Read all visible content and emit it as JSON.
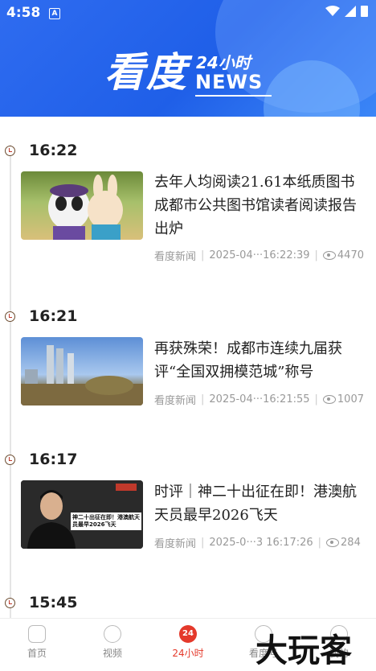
{
  "status_bar": {
    "time": "4:58",
    "notif_badge": "A"
  },
  "header": {
    "logo_cn": "看度",
    "logo_24": "24小时",
    "logo_news": "NEWS"
  },
  "timeline": [
    {
      "time": "16:22",
      "title": "去年人均阅读21.61本纸质图书 成都市公共图书馆读者阅读报告出炉",
      "source": "看度新闻",
      "date": "2025-04···16:22:39",
      "views": "4470"
    },
    {
      "time": "16:21",
      "title": "再获殊荣！成都市连续九届获评“全国双拥模范城”称号",
      "source": "看度新闻",
      "date": "2025-04···16:21:55",
      "views": "1007"
    },
    {
      "time": "16:17",
      "title": "时评｜神二十出征在即！港澳航天员最早2026飞天",
      "source": "看度新闻",
      "date": "2025-0···3 16:17:26",
      "views": "284",
      "thumb_caption": "神二十出征在即！港澳航天员最早2026飞天"
    },
    {
      "time": "15:45"
    }
  ],
  "tabbar": [
    {
      "label": "首页",
      "icon": "home-icon"
    },
    {
      "label": "视频",
      "icon": "play-icon"
    },
    {
      "label": "24小时",
      "icon": "clock-24-icon",
      "active": true
    },
    {
      "label": "看度号",
      "icon": "account-icon"
    },
    {
      "label": "我的",
      "icon": "profile-icon"
    }
  ],
  "watermark": "大玩客",
  "colors": {
    "header_blue": "#1f5fe8",
    "accent_red": "#e4392b"
  }
}
